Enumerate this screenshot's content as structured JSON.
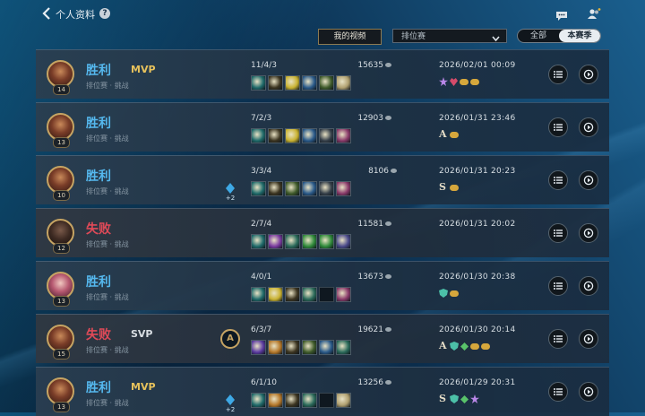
{
  "header": {
    "title": "个人资料",
    "help": "?"
  },
  "filters": {
    "videos_label": "我的视频",
    "queue_selected": "排位赛",
    "tabs": [
      {
        "label": "全部",
        "active": false
      },
      {
        "label": "本赛季",
        "active": true
      }
    ]
  },
  "matches": [
    {
      "result": "胜利",
      "outcome": "win",
      "mode": "排位赛 · 挑战",
      "level": "14",
      "badge": "MVP",
      "kda": "11/4/3",
      "gold": "15635",
      "date": "2026/02/01 00:09",
      "items": [
        "#1f6a6a",
        "#3b3420",
        "#c9b231",
        "#2a5a8a",
        "#3e5a2a",
        "#b0a070"
      ],
      "honors": [
        "star",
        "heart",
        "coin",
        "coin"
      ],
      "augment": null,
      "avatar": "brown"
    },
    {
      "result": "胜利",
      "outcome": "win",
      "mode": "排位赛 · 挑战",
      "level": "13",
      "badge": "",
      "kda": "7/2/3",
      "gold": "12903",
      "date": "2026/01/31 23:46",
      "items": [
        "#1f6a6a",
        "#3b3420",
        "#c9b231",
        "#2a5a8a",
        "#36404a",
        "#8a3a6a"
      ],
      "honors": [
        "A",
        "coin"
      ],
      "augment": null,
      "avatar": "brown"
    },
    {
      "result": "胜利",
      "outcome": "win",
      "mode": "排位赛 · 挑战",
      "level": "10",
      "badge": "",
      "kda": "3/3/4",
      "gold": "8106",
      "date": "2026/01/31 20:23",
      "items": [
        "#1f6a6a",
        "#3b3420",
        "#3e5a2a",
        "#2a5a8a",
        "#36404a",
        "#8a3a6a"
      ],
      "honors": [
        "S",
        "coin"
      ],
      "augment": "+2",
      "avatar": "brown"
    },
    {
      "result": "失败",
      "outcome": "loss",
      "mode": "排位赛 · 挑战",
      "level": "12",
      "badge": "",
      "kda": "2/7/4",
      "gold": "11581",
      "date": "2026/01/31 20:02",
      "items": [
        "#1f6a6a",
        "#7a3aa0",
        "#2a6a5a",
        "#2f8a3a",
        "#2f8a3a",
        "#4a4a8a"
      ],
      "honors": [],
      "augment": null,
      "avatar": "dark"
    },
    {
      "result": "胜利",
      "outcome": "win",
      "mode": "排位赛 · 挑战",
      "level": "13",
      "badge": "",
      "kda": "4/0/1",
      "gold": "13673",
      "date": "2026/01/30 20:38",
      "items": [
        "#1f6a6a",
        "#c9b231",
        "#3b3420",
        "#2a6a5a",
        "empty",
        "#8a3a6a"
      ],
      "honors": [
        "shield",
        "coin"
      ],
      "augment": null,
      "avatar": "rose"
    },
    {
      "result": "失败",
      "outcome": "loss",
      "mode": "排位赛 · 挑战",
      "level": "15",
      "badge": "SVP",
      "kda": "6/3/7",
      "gold": "19621",
      "date": "2026/01/30 20:14",
      "items": [
        "#5a3aa0",
        "#b5782a",
        "#3b3420",
        "#3e5a2a",
        "#2a5a8a",
        "#2a6a5a"
      ],
      "honors": [
        "A",
        "shield",
        "leaf",
        "coin",
        "coin"
      ],
      "augment": "emblem",
      "avatar": "brown"
    },
    {
      "result": "胜利",
      "outcome": "win",
      "mode": "排位赛 · 挑战",
      "level": "13",
      "badge": "MVP",
      "kda": "6/1/10",
      "gold": "13256",
      "date": "2026/01/29 20:31",
      "items": [
        "#1f6a6a",
        "#b5782a",
        "#3b3420",
        "#2a6a5a",
        "empty",
        "#b0a070"
      ],
      "honors": [
        "S",
        "shield",
        "leaf",
        "star"
      ],
      "augment": "+2",
      "avatar": "brown"
    }
  ]
}
